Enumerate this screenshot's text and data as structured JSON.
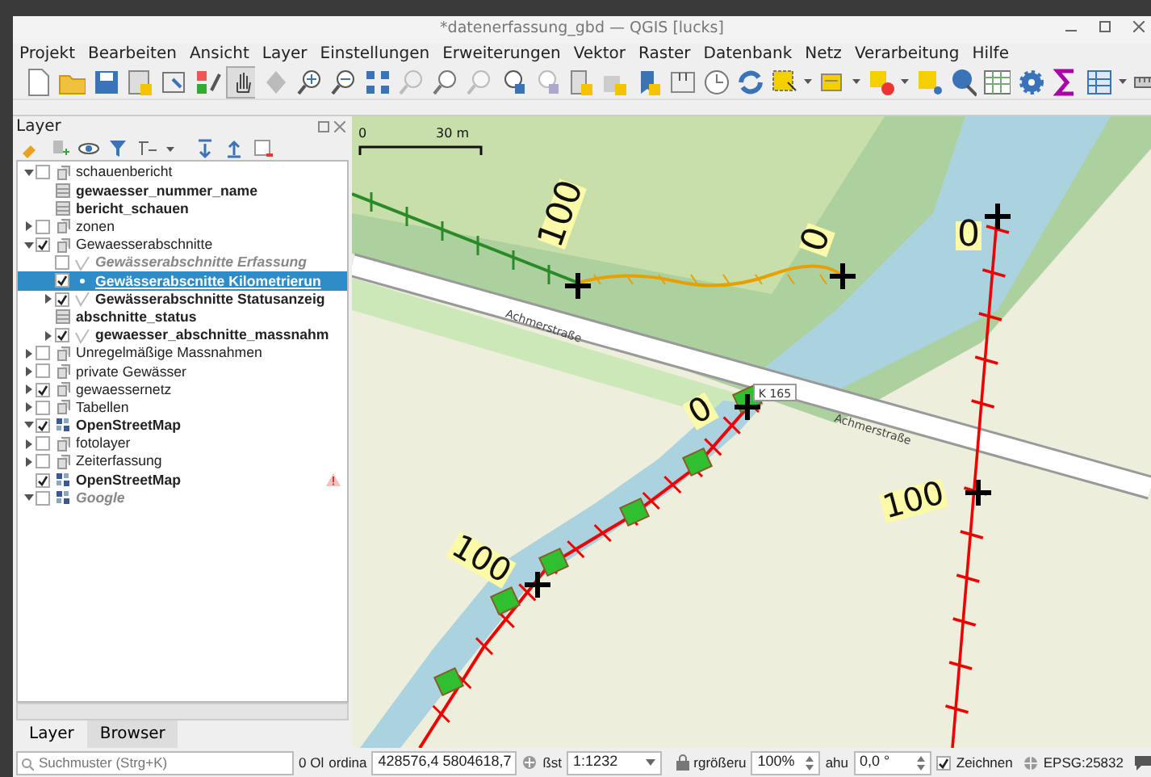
{
  "window": {
    "title": "*datenerfassung_gbd — QGIS [lucks]"
  },
  "menu": [
    "Projekt",
    "Bearbeiten",
    "Ansicht",
    "Layer",
    "Einstellungen",
    "Erweiterungen",
    "Vektor",
    "Raster",
    "Datenbank",
    "Netz",
    "Verarbeitung",
    "Hilfe"
  ],
  "layers_panel": {
    "title": "Layer",
    "tree": [
      {
        "name": "schauenbericht",
        "kind": "group",
        "checked": false,
        "expanded": true,
        "children": [
          {
            "name": "gewaesser_nummer_name",
            "kind": "table",
            "bold": true
          },
          {
            "name": "bericht_schauen",
            "kind": "table",
            "bold": true
          }
        ]
      },
      {
        "name": "zonen",
        "kind": "group",
        "checked": false,
        "expanded": false
      },
      {
        "name": "Gewaesserabschnitte",
        "kind": "group",
        "checked": true,
        "expanded": true,
        "children": [
          {
            "name": "Gewässerabschnitte Erfassung",
            "kind": "vector",
            "checked": false,
            "bold": true,
            "muted": true
          },
          {
            "name": "Gewässerabscnitte Kilometrierun",
            "kind": "point",
            "checked": true,
            "bold": true,
            "selected": true
          },
          {
            "name": "Gewässerabschnitte Statusanzeig",
            "kind": "vector",
            "checked": true,
            "expanded": false,
            "bold": true
          },
          {
            "name": "abschnitte_status",
            "kind": "table",
            "bold": true
          },
          {
            "name": "gewaesser_abschnitte_massnahm",
            "kind": "vector",
            "checked": true,
            "expanded": false,
            "bold": true
          }
        ]
      },
      {
        "name": "Unregelmäßige Massnahmen",
        "kind": "group",
        "checked": false,
        "expanded": false
      },
      {
        "name": "private Gewässer",
        "kind": "group",
        "checked": false,
        "expanded": false
      },
      {
        "name": "gewaessernetz",
        "kind": "group",
        "checked": true,
        "expanded": false
      },
      {
        "name": "Tabellen",
        "kind": "group",
        "checked": false,
        "expanded": false
      },
      {
        "name": "OpenStreetMap",
        "kind": "raster",
        "checked": true,
        "expanded": true,
        "bold": true
      },
      {
        "name": "fotolayer",
        "kind": "group",
        "checked": false,
        "expanded": false
      },
      {
        "name": "Zeiterfassung",
        "kind": "group",
        "checked": false,
        "expanded": false
      },
      {
        "name": "OpenStreetMap",
        "kind": "raster",
        "checked": true,
        "bold": true,
        "warning": true
      },
      {
        "name": "Google",
        "kind": "raster",
        "checked": false,
        "expanded": true,
        "bold": true,
        "muted": true
      }
    ],
    "tabs": [
      {
        "label": "Layer",
        "selected": true
      },
      {
        "label": "Browser",
        "selected": false
      }
    ]
  },
  "map": {
    "scale_labels": [
      "0",
      "30 m"
    ],
    "labels": [
      {
        "text": "100",
        "kind": "station"
      },
      {
        "text": "0",
        "kind": "station"
      },
      {
        "text": "0",
        "kind": "station"
      },
      {
        "text": "100",
        "kind": "station"
      },
      {
        "text": "0",
        "kind": "station"
      },
      {
        "text": "100",
        "kind": "station"
      },
      {
        "text": "Achmerstraße",
        "kind": "street"
      },
      {
        "text": "Achmerstraße",
        "kind": "street"
      },
      {
        "text": "K 165",
        "kind": "ref"
      }
    ]
  },
  "status_bar": {
    "search": {
      "placeholder": "Suchmuster (Strg+K)"
    },
    "message": "0 Ol",
    "coordinate_label": "ordina",
    "coordinate": "428576,4 5804618,7",
    "scale_label": "ßst",
    "scale": "1:1232",
    "magnifier_label": "rgrößeru",
    "magnifier": "100%",
    "rotation_label": "ahu",
    "rotation": "0,0 °",
    "render": {
      "label": "Zeichnen",
      "checked": true
    },
    "crs": "EPSG:25832"
  }
}
